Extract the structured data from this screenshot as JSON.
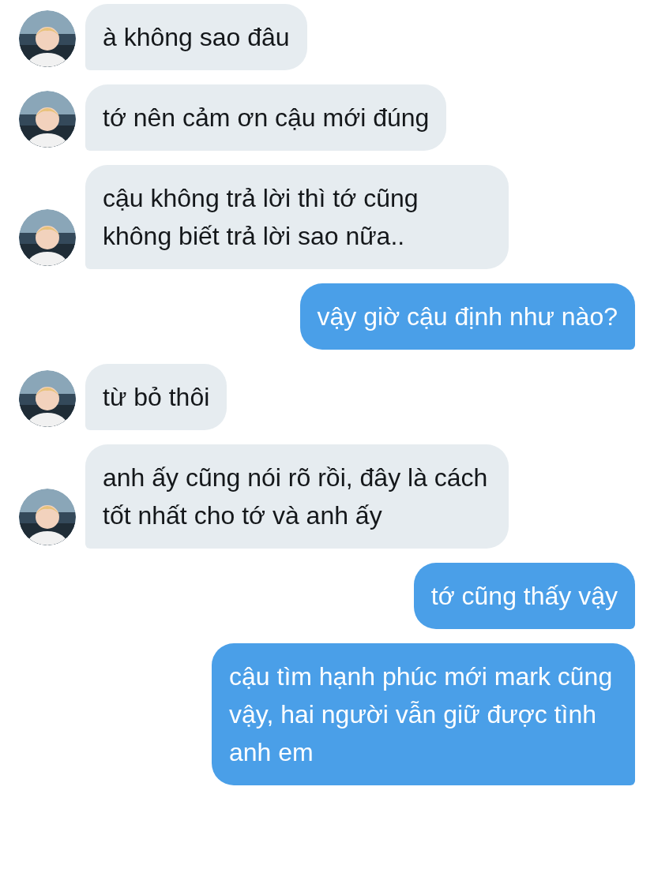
{
  "messages": [
    {
      "kind": "received",
      "text": "à không sao đâu"
    },
    {
      "kind": "received",
      "text": "tớ nên cảm ơn cậu mới đúng"
    },
    {
      "kind": "received",
      "text": "cậu không trả lời thì tớ cũng không biết trả lời sao nữa.."
    },
    {
      "kind": "sent",
      "text": "vậy giờ cậu định như nào?"
    },
    {
      "kind": "received",
      "text": "từ bỏ thôi"
    },
    {
      "kind": "received",
      "text": "anh ấy cũng nói rõ rồi, đây là cách tốt nhất cho tớ và anh ấy"
    },
    {
      "kind": "sent",
      "text": "tớ cũng thấy vậy"
    },
    {
      "kind": "sent",
      "text": "cậu tìm hạnh phúc mới mark cũng vậy, hai người vẫn giữ được tình anh em"
    }
  ]
}
